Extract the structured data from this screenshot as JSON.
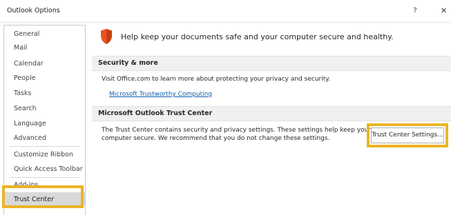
{
  "window": {
    "title": "Outlook Options",
    "help_label": "?",
    "close_label": "✕"
  },
  "sidebar": {
    "items": [
      {
        "label": "General"
      },
      {
        "label": "Mail"
      },
      {
        "label": "Calendar"
      },
      {
        "label": "People"
      },
      {
        "label": "Tasks"
      },
      {
        "label": "Search"
      },
      {
        "label": "Language"
      },
      {
        "label": "Advanced"
      },
      {
        "label": "Customize Ribbon"
      },
      {
        "label": "Quick Access Toolbar"
      },
      {
        "label": "Add-ins"
      },
      {
        "label": "Trust Center"
      }
    ],
    "selected": "Trust Center"
  },
  "main": {
    "hero_text": "Help keep your documents safe and your computer secure and healthy.",
    "security_section": {
      "header": "Security & more",
      "description": "Visit Office.com to learn more about protecting your privacy and security.",
      "link": "Microsoft Trustworthy Computing"
    },
    "trust_center_section": {
      "header": "Microsoft Outlook Trust Center",
      "description_line1": "The Trust Center contains security and privacy settings. These settings help keep your",
      "description_line2": "computer secure. We recommend that you do not change these settings.",
      "button_label": "Trust Center Settings..."
    }
  },
  "colors": {
    "highlight": "#ecb325",
    "link": "#0f5bad",
    "shield": "#e8541e",
    "section_header_bg": "#f0f0f0",
    "selected_bg": "#d9d9d9"
  }
}
